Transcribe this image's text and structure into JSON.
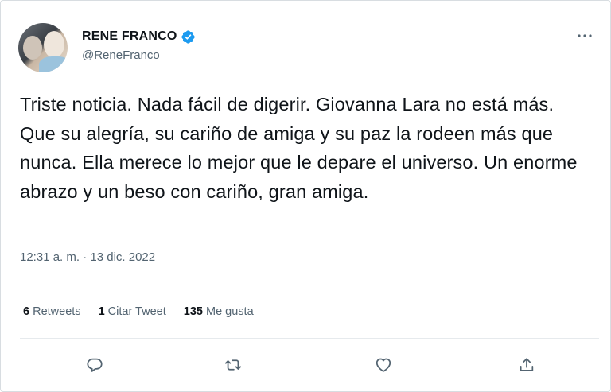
{
  "author": {
    "display_name": "RENE FRANCO",
    "handle": "@ReneFranco",
    "verified": true
  },
  "tweet": {
    "text": "Triste noticia. Nada fácil de digerir. Giovanna Lara no está más. Que su alegría, su cariño de amiga y su paz la rodeen más que nunca. Ella merece lo mejor que le depare el universo. Un enorme abrazo y un beso con cariño, gran amiga.",
    "timestamp": "12:31 a. m. · 13 dic. 2022"
  },
  "stats": {
    "retweets_count": "6",
    "retweets_label": "Retweets",
    "quotes_count": "1",
    "quotes_label": "Citar Tweet",
    "likes_count": "135",
    "likes_label": "Me gusta"
  },
  "colors": {
    "verified": "#1d9bf0",
    "secondary_text": "#536471",
    "primary_text": "#0f1419"
  },
  "icons": {
    "more": "more-icon",
    "reply": "reply-icon",
    "retweet": "retweet-icon",
    "like": "heart-icon",
    "share": "share-icon"
  }
}
